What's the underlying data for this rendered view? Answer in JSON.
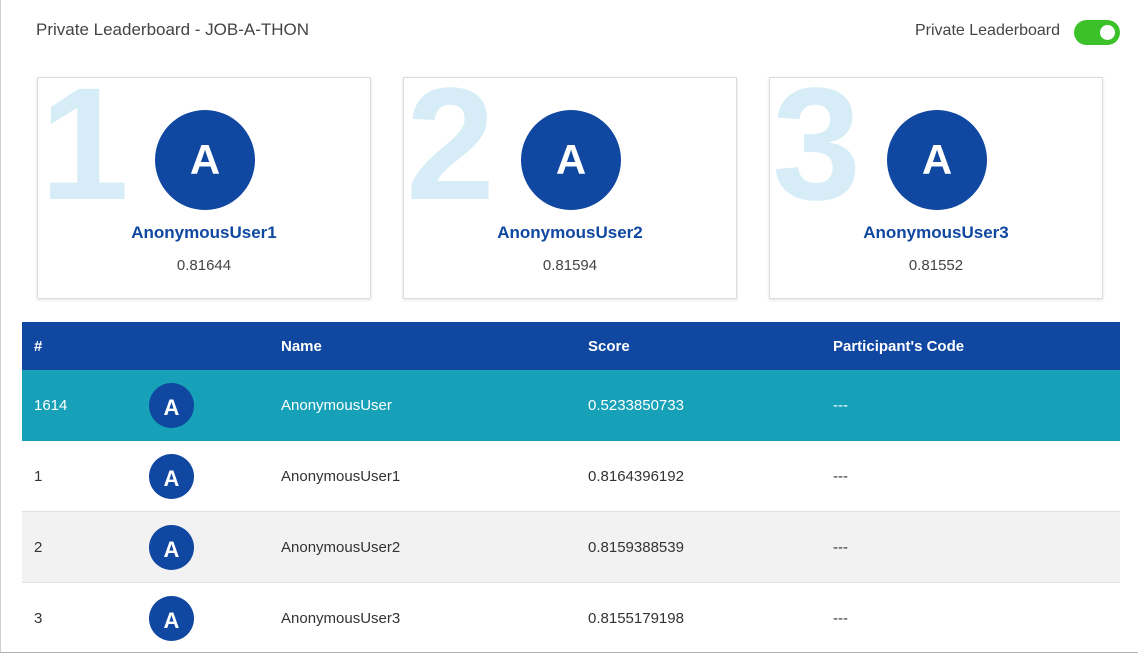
{
  "header": {
    "title": "Private Leaderboard - JOB-A-THON",
    "toggle_label": "Private Leaderboard",
    "toggle_on": true,
    "toggle_color": "#3cc12b"
  },
  "colors": {
    "primary": "#0f47a1",
    "highlight_row": "#17a1b8",
    "rank_watermark": "#d6edf7"
  },
  "podium": [
    {
      "rank": "1",
      "avatar_letter": "A",
      "name": "AnonymousUser1",
      "score": "0.81644"
    },
    {
      "rank": "2",
      "avatar_letter": "A",
      "name": "AnonymousUser2",
      "score": "0.81594"
    },
    {
      "rank": "3",
      "avatar_letter": "A",
      "name": "AnonymousUser3",
      "score": "0.81552"
    }
  ],
  "table": {
    "columns": [
      "#",
      "Name",
      "Score",
      "Participant's Code"
    ],
    "rows": [
      {
        "rank": "1614",
        "avatar_letter": "A",
        "name": "AnonymousUser",
        "score": "0.5233850733",
        "code": "---"
      },
      {
        "rank": "1",
        "avatar_letter": "A",
        "name": "AnonymousUser1",
        "score": "0.8164396192",
        "code": "---"
      },
      {
        "rank": "2",
        "avatar_letter": "A",
        "name": "AnonymousUser2",
        "score": "0.8159388539",
        "code": "---"
      },
      {
        "rank": "3",
        "avatar_letter": "A",
        "name": "AnonymousUser3",
        "score": "0.8155179198",
        "code": "---"
      }
    ]
  }
}
